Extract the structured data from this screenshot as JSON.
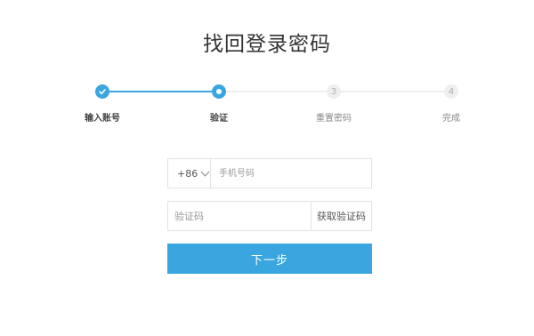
{
  "page": {
    "title": "找回登录密码"
  },
  "stepper": {
    "steps": [
      {
        "label": "输入账号",
        "status": "done",
        "icon": "check-icon"
      },
      {
        "label": "验证",
        "status": "current"
      },
      {
        "label": "重置密码",
        "status": "pending",
        "number": "3"
      },
      {
        "label": "完成",
        "status": "pending",
        "number": "4"
      }
    ]
  },
  "form": {
    "country_code": "+86",
    "phone_placeholder": "手机号码",
    "phone_value": "",
    "code_placeholder": "验证码",
    "code_value": "",
    "get_code_label": "获取验证码",
    "next_label": "下一步"
  },
  "colors": {
    "accent": "#3aa6e0",
    "pending_step_bg": "#efefef",
    "border": "#e3e3e3"
  }
}
